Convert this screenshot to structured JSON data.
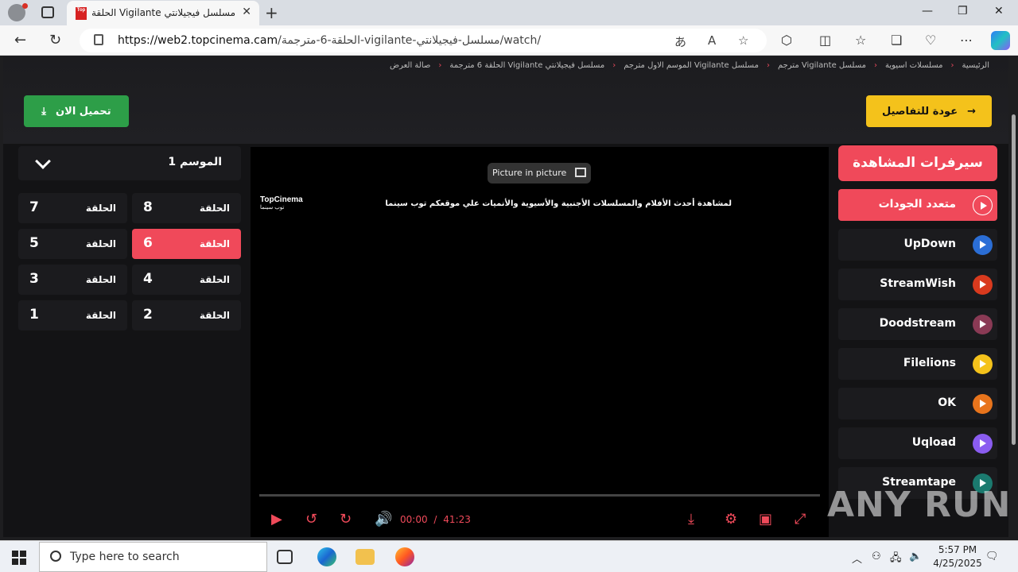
{
  "browser": {
    "tab_title": "مسلسل فيجيلانتي Vigilante الحلقة",
    "favicon_text": "Top",
    "url_host": "https://web2.topcinema.cam",
    "url_path": "/الحلقة-6-مترجمة-vigilante-مسلسل-فيجيلانتي/watch/"
  },
  "breadcrumb": [
    "الرئيسية",
    "مسلسلات اسيوية",
    "مسلسل Vigilante مترجم",
    "مسلسل Vigilante الموسم الاول مترجم",
    "مسلسل فيجيلانتي Vigilante الحلقة 6 مترجمة",
    "صالة العرض"
  ],
  "actions": {
    "download": "تحميل الان",
    "back": "عودة للتفاصيل"
  },
  "season": {
    "label": "الموسم 1"
  },
  "episodes": {
    "label": "الحلقة",
    "items": [
      "8",
      "7",
      "6",
      "5",
      "4",
      "3",
      "2",
      "1"
    ],
    "active": "6"
  },
  "player": {
    "pip": "Picture in picture",
    "logo_en": "TopCinema",
    "logo_ar": "توب سينما",
    "notice": "لمشاهدة أحدث الأفلام والمسلسلات الأجنبية والأسيوية والأنميات علي موقعكم توب سينما",
    "time_current": "00:00",
    "time_sep": "/",
    "time_total": "41:23"
  },
  "servers": {
    "title": "سيرفرات المشاهدة",
    "items": [
      {
        "name": "متعدد الجودات",
        "color": "#f0495a"
      },
      {
        "name": "UpDown",
        "color": "#2b6ed6"
      },
      {
        "name": "StreamWish",
        "color": "#d93a1e"
      },
      {
        "name": "Doodstream",
        "color": "#8a3a55"
      },
      {
        "name": "Filelions",
        "color": "#f4c21b"
      },
      {
        "name": "OK",
        "color": "#e8741c"
      },
      {
        "name": "Uqload",
        "color": "#8a5cf0"
      },
      {
        "name": "Streamtape",
        "color": "#1b7a6f"
      }
    ]
  },
  "watermark": "ANY RUN",
  "taskbar": {
    "search_placeholder": "Type here to search",
    "time": "5:57 PM",
    "date": "4/25/2025"
  }
}
